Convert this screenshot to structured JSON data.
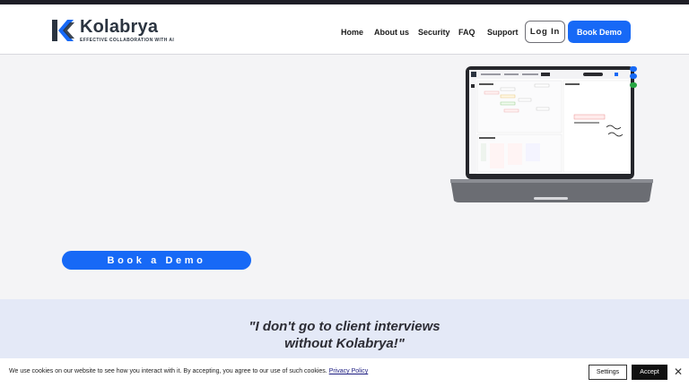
{
  "brand": {
    "name": "Kolabrya",
    "tagline": "EFFECTIVE COLLABORATION WITH AI",
    "colors": {
      "primary": "#1769f6",
      "dark": "#2b3440",
      "accent_light": "#e4e9f7"
    }
  },
  "nav": {
    "items": [
      {
        "label": "Home"
      },
      {
        "label": "About us"
      },
      {
        "label": "Security"
      },
      {
        "label": "FAQ"
      },
      {
        "label": "Support"
      }
    ],
    "login_label": "Log In",
    "book_demo_label": "Book Demo"
  },
  "hero": {
    "cta_label": "Book a Demo",
    "image_icon": "laptop-screenshot-image"
  },
  "testimonial": {
    "line1": "\"I don't go to client interviews",
    "line2": "without Kolabrya!\""
  },
  "cookie_banner": {
    "text": "We use cookies on our website to see how you interact with it. By accepting, you agree to our use of such cookies.",
    "link_label": "Privacy Policy",
    "settings_label": "Settings",
    "accept_label": "Accept",
    "close_icon": "close-icon"
  }
}
